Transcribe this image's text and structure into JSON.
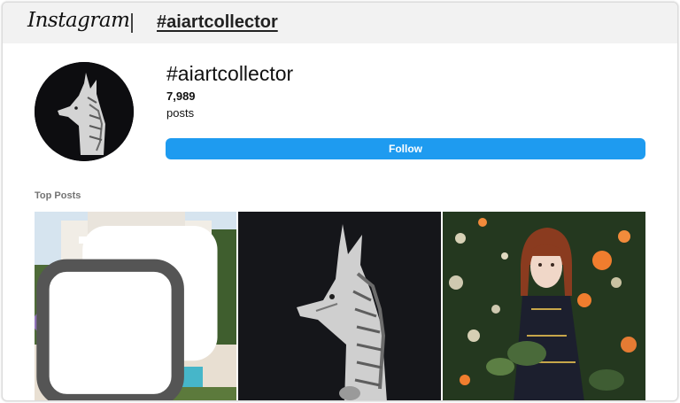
{
  "header": {
    "logo_text": "Instagram",
    "hashtag_link": "#aiartcollector"
  },
  "profile": {
    "title": "#aiartcollector",
    "post_count": "7,989",
    "post_label": "posts",
    "follow_label": "Follow",
    "avatar_icon": "dragon-sculpture-image"
  },
  "top_posts": {
    "title": "Top Posts",
    "posts": [
      {
        "subject": "mediterranean-villa-image",
        "multi_image_badge": "carousel-icon"
      },
      {
        "subject": "dragon-sculpture-image"
      },
      {
        "subject": "girl-in-flower-garden-image"
      }
    ]
  },
  "colors": {
    "accent": "#1e9bf0",
    "header_bg": "#f2f2f2"
  }
}
